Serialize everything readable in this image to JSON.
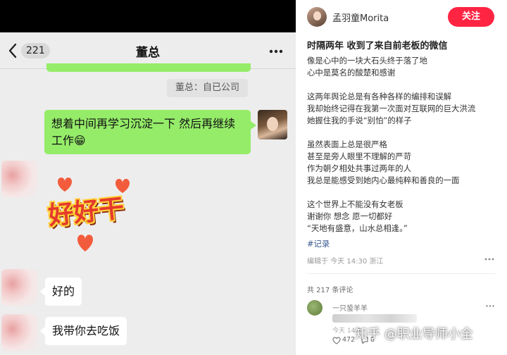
{
  "chat": {
    "unread_badge": "221",
    "title": "董总",
    "quote_text": "董总：自已公司",
    "sent_message": "想着中间再学习沉淀一下 然后再继续工作😁",
    "sticker_text": "好好干",
    "received_messages": [
      "好的",
      "我带你去吃饭"
    ],
    "colors": {
      "sent_bubble": "#95ec69",
      "background": "#ededed"
    }
  },
  "post": {
    "author": "孟羽童Morita",
    "follow_label": "关注",
    "title": "时隔两年 收到了来自前老板的微信",
    "paragraphs": [
      [
        "像是心中的一块大石头终于落了地",
        "心中是莫名的酸楚和感谢"
      ],
      [
        "这两年舆论总是有各种各样的编排和误解",
        "我却始终记得在我第一次面对互联网的巨大洪流",
        "她握住我的手说“别怕”的样子"
      ],
      [
        "虽然表面上总是很严格",
        "甚至是旁人眼里不理解的严苛",
        "作为朝夕相处共事过两年的人",
        "我总是能感受到她内心最纯粹和善良的一面"
      ],
      [
        "这个世界上不能没有女老板",
        "谢谢你 想念 愿一切都好",
        "“天地有盛意，山水总相逢。”"
      ]
    ],
    "hashtag": "#记录",
    "meta": "编辑于 今天 14:30 浙江",
    "comment_count": "共 217 条评论",
    "comment": {
      "name": "一只蛩羊羊",
      "time": "今天 14:2",
      "likes": "472",
      "replies": "8"
    },
    "colors": {
      "follow": "#ff2442",
      "hashtag": "#3b5a8f"
    }
  },
  "watermark": "知乎 @职业导师小全"
}
